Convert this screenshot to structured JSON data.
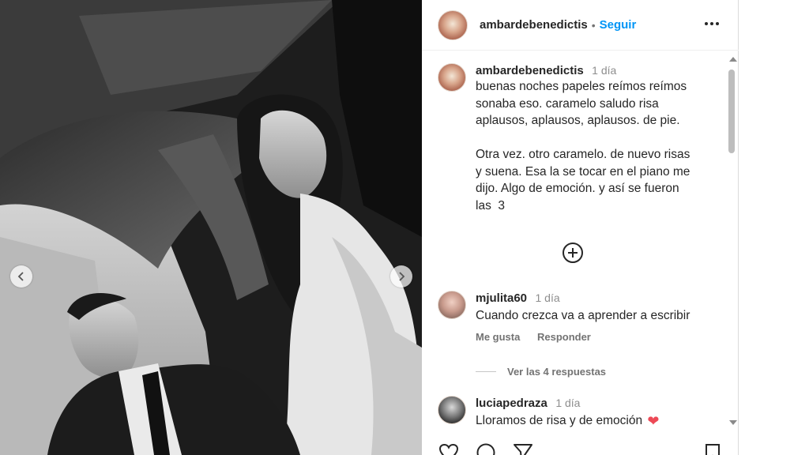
{
  "post": {
    "author": "ambardebenedictis",
    "follow_label": "Seguir",
    "separator": "•"
  },
  "caption": {
    "username": "ambardebenedictis",
    "time": "1 día",
    "lines": [
      "buenas noches papeles reímos reímos",
      "sonaba eso. caramelo saludo risa",
      "aplausos, aplausos, aplausos. de pie.",
      "",
      "Otra vez. otro caramelo. de nuevo risas",
      "y suena. Esa la se tocar en el piano me",
      "dijo. Algo de emoción. y así se fueron",
      "las  3"
    ]
  },
  "comments": [
    {
      "username": "mjulita60",
      "time": "1 día",
      "text": "Cuando crezca va a aprender a escribir",
      "like_label": "Me gusta",
      "reply_label": "Responder",
      "replies_label": "Ver las 4 respuestas"
    },
    {
      "username": "luciapedraza",
      "time": "1 día",
      "text": "Lloramos de risa y de emoción",
      "emoji": "❤"
    }
  ],
  "icons": {
    "more": "more-horizontal-icon",
    "add": "plus-circle-icon",
    "prev": "chevron-left-icon",
    "next": "chevron-right-icon",
    "like": "heart-icon",
    "comment": "comment-icon",
    "share": "send-icon",
    "save": "bookmark-icon"
  },
  "colors": {
    "link": "#0095f6",
    "heart": "#ed4956",
    "muted": "#737373"
  }
}
